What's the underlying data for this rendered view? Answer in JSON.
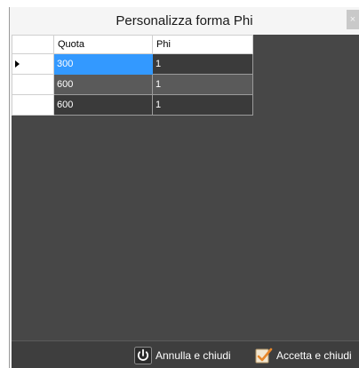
{
  "window": {
    "title": "Personalizza forma Phi",
    "close_glyph": "×"
  },
  "grid": {
    "columns": [
      "Quota",
      "Phi"
    ],
    "current_row": 0,
    "rows": [
      {
        "quota": "300",
        "phi": "1"
      },
      {
        "quota": "600",
        "phi": "1"
      },
      {
        "quota": "600",
        "phi": "1"
      }
    ]
  },
  "buttons": {
    "cancel_label": "Annulla e chiudi",
    "cancel_icon": "power-icon",
    "accept_label": "Accetta e chiudi",
    "accept_icon": "checkmark-icon"
  },
  "colors": {
    "selection": "#3399ff",
    "panel": "#474747"
  }
}
